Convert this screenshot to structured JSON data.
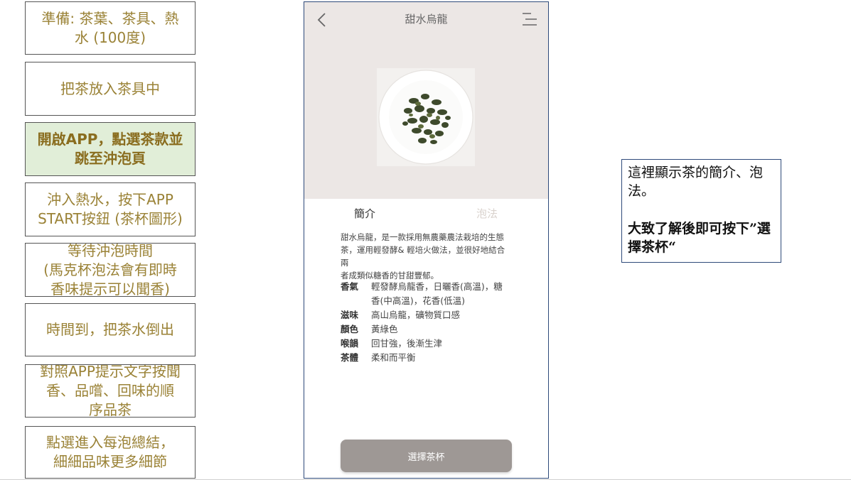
{
  "steps": [
    {
      "label": "準備: 茶葉、茶具、熱\n水 (100度)"
    },
    {
      "label": "把茶放入茶具中"
    },
    {
      "label": "開啟APP，點選茶款並\n跳至沖泡頁"
    },
    {
      "label": "沖入熱水，按下APP\nSTART按鈕 (茶杯圖形)"
    },
    {
      "label": "等待沖泡時間\n(馬克杯泡法會有即時\n香味提示可以聞香)"
    },
    {
      "label": "時間到，把茶水倒出"
    },
    {
      "label": "對照APP提示文字按聞\n香、品嚐、回味的順\n序品茶"
    },
    {
      "label": "點選進入每泡總結，\n細細品味更多細節"
    }
  ],
  "active_step": 2,
  "phone": {
    "title": "甜水烏龍",
    "back_icon": "chevron-left-icon",
    "menu_icon": "menu-lines-icon",
    "tabs": {
      "intro": "簡介",
      "method": "泡法"
    },
    "description": "甜水烏龍，是一款採用無農藥農法栽培的生態\n茶，運用輕發酵& 輕培火做法，並很好地結合兩\n者成類似糖香的甘甜豐郁。",
    "attributes": [
      {
        "key": "香氣",
        "value": "輕發酵烏龍香，日曬香(高溫)，糖\n香(中高溫)，花香(低溫)"
      },
      {
        "key": "滋味",
        "value": "高山烏龍，礦物質口感"
      },
      {
        "key": "顏色",
        "value": "黃綠色"
      },
      {
        "key": "喉韻",
        "value": "回甘強，後漸生津"
      },
      {
        "key": "茶體",
        "value": "柔和而平衡"
      }
    ],
    "button_label": "選擇茶杯"
  },
  "note": {
    "line1": "這裡顯示茶的簡介、泡法。",
    "line2": "大致了解後即可按下”選擇茶杯“"
  },
  "colors": {
    "step_text": "#9a8236",
    "active_step_bg": "#e1eed8",
    "phone_header_bg": "#ece7e5",
    "button_bg": "#9e9895",
    "frame_border": "#2e4a7a"
  }
}
